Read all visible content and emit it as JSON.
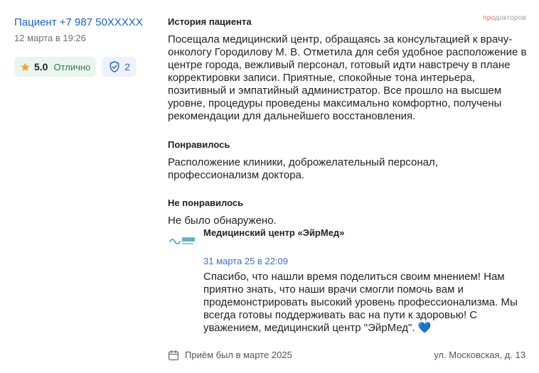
{
  "patient": {
    "name": "Пациент +7 987 50XXXXX",
    "date": "12 марта в 19:26"
  },
  "rating": {
    "value": "5.0",
    "label": "Отлично",
    "icon": "star-icon",
    "color": "#f5a623"
  },
  "verification": {
    "count": "2",
    "icon": "shield-check-icon"
  },
  "logo": {
    "part1": "про",
    "part2": "докторов"
  },
  "story": {
    "title": "История пациента",
    "text": "Посещала медицинский центр, обращаясь за консультацией к врачу-онкологу Городилову М. В. Отметила для себя удобное расположение в центре города, вежливый персонал, готовый идти навстречу в плане корректировки записи. Приятные, спокойные тона интерьера, позитивный и эмпатийный администратор. Все прошло на высшем уровне, процедуры проведены максимально комфортно, получены рекомендации для дальнейшего восстановления."
  },
  "liked": {
    "title": "Понравилось",
    "text": "Расположение клиники, доброжелательный персонал, профессионализм доктора."
  },
  "disliked": {
    "title": "Не понравилось",
    "text": "Не было обнаружено."
  },
  "reply": {
    "clinic_name": "Медицинский центр «ЭйрМед»",
    "date": "31 марта 25 в 22:09",
    "text": "Спасибо, что нашли время поделиться своим мнением! Нам приятно знать, что наши врачи смогли помочь вам и продемонстрировать высокий уровень профессионализма. Мы всегда готовы поддерживать вас на пути к здоровью! С уважением, медицинский центр \"ЭйрМед\".",
    "heart": "💙"
  },
  "footer": {
    "visit": "Приём был в марте 2025",
    "address": "ул. Московская, д. 13"
  }
}
